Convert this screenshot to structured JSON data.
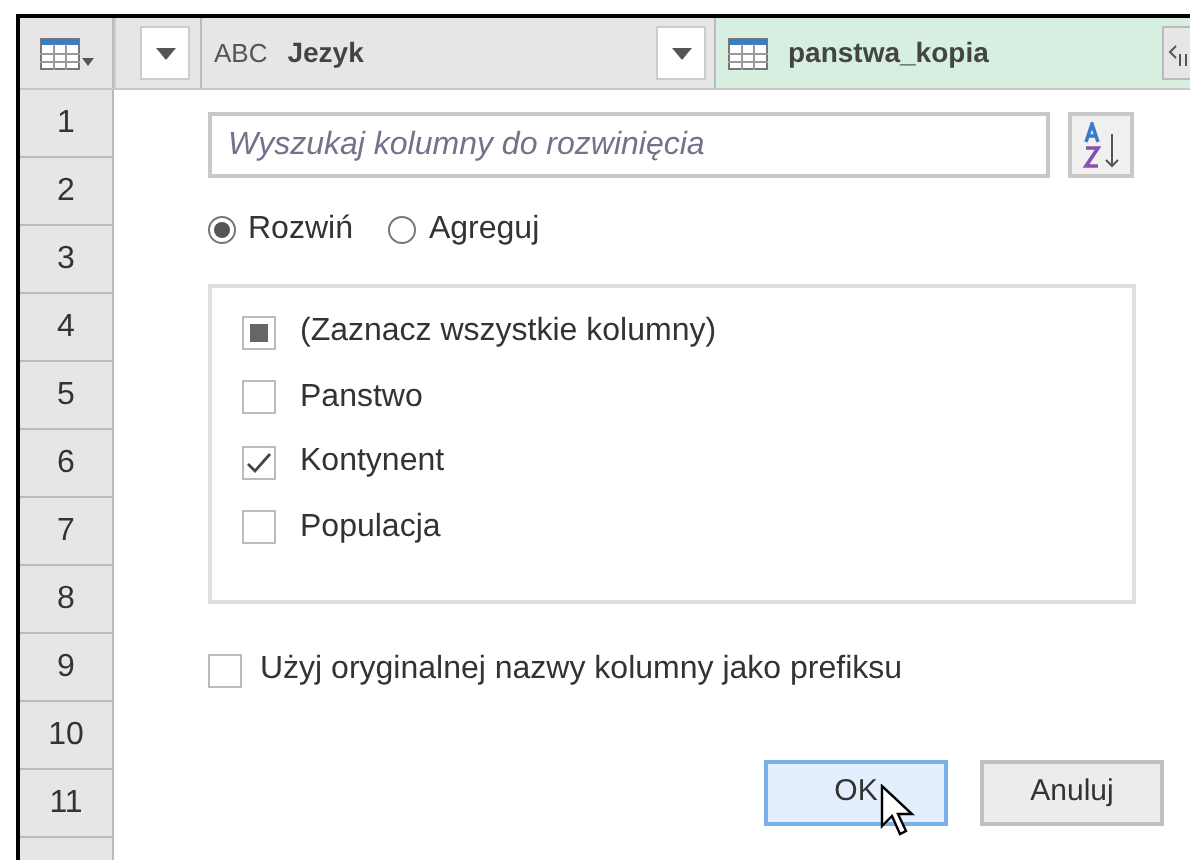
{
  "header": {
    "columns": [
      {
        "kind": "text",
        "label": "Jezyk",
        "type_label": "ABC"
      },
      {
        "kind": "table",
        "label": "panstwa_kopia"
      }
    ]
  },
  "row_numbers": [
    "1",
    "2",
    "3",
    "4",
    "5",
    "6",
    "7",
    "8",
    "9",
    "10",
    "11"
  ],
  "dialog": {
    "search": {
      "placeholder": "Wyszukaj kolumny do rozwinięcia"
    },
    "modes": [
      {
        "label": "Rozwiń",
        "selected": true
      },
      {
        "label": "Agreguj",
        "selected": false
      }
    ],
    "columns": [
      {
        "label": "(Zaznacz wszystkie kolumny)",
        "checked": false,
        "indeterminate": true
      },
      {
        "label": "Panstwo",
        "checked": false,
        "indeterminate": false
      },
      {
        "label": "Kontynent",
        "checked": true,
        "indeterminate": false
      },
      {
        "label": "Populacja",
        "checked": false,
        "indeterminate": false
      }
    ],
    "prefix": {
      "label": "Użyj oryginalnej nazwy kolumny jako prefiksu",
      "checked": false
    },
    "buttons": [
      {
        "label": "OK",
        "hovered": true
      },
      {
        "label": "Anuluj",
        "hovered": false
      }
    ]
  }
}
